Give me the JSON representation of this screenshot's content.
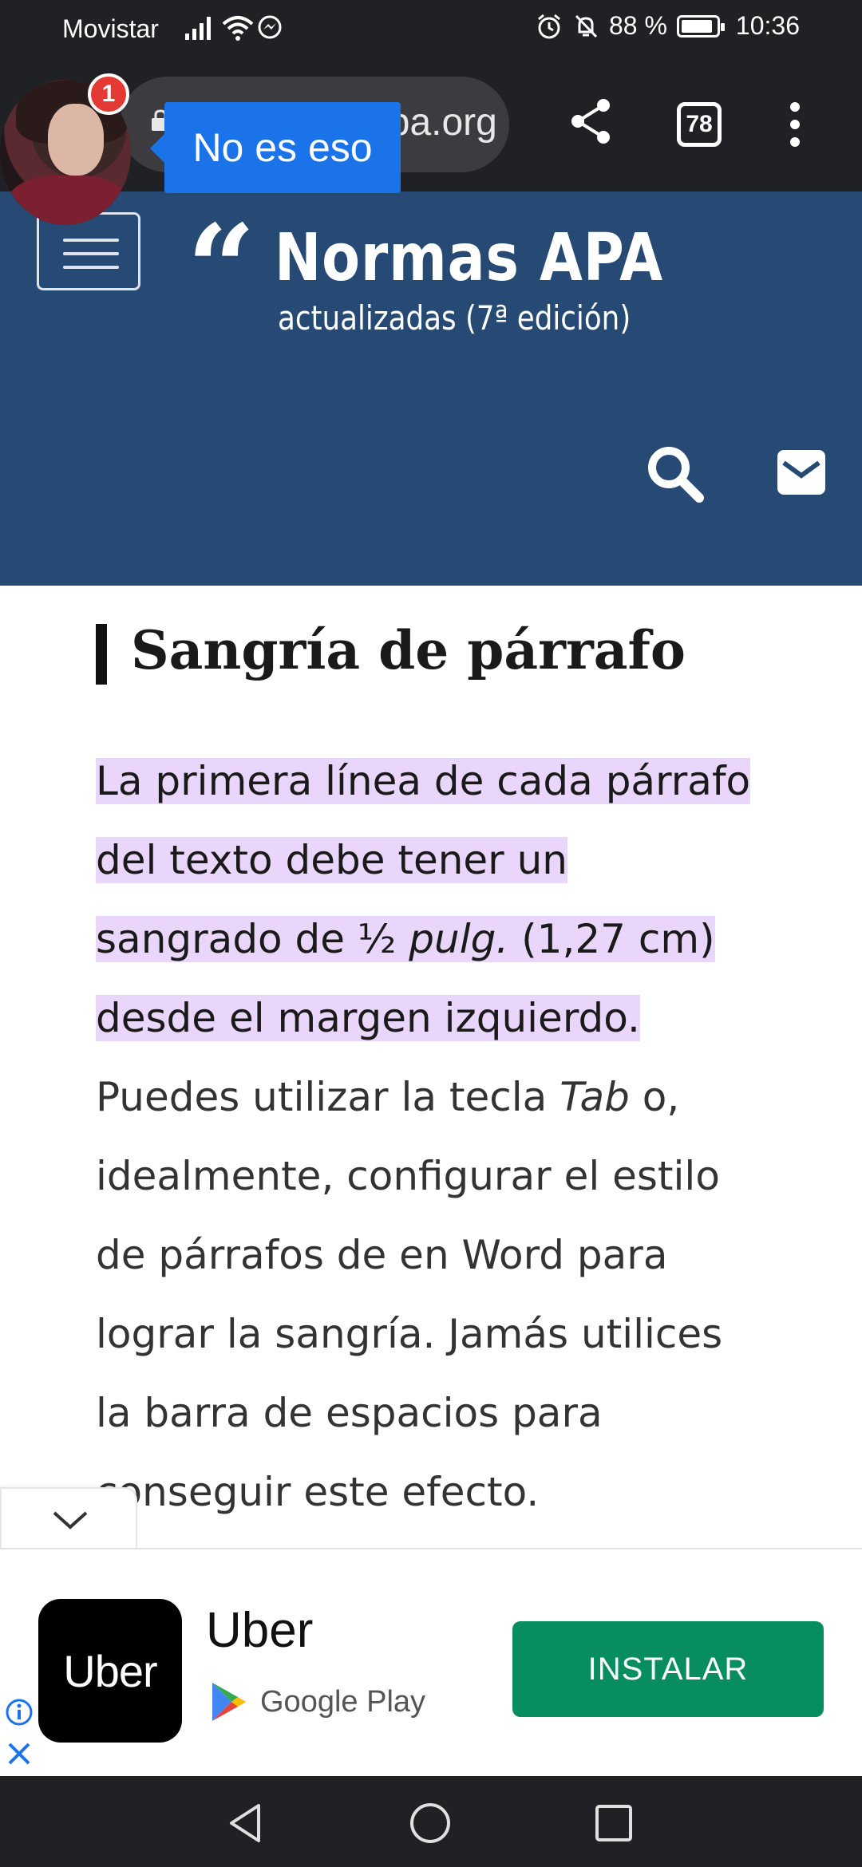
{
  "status_bar": {
    "carrier": "Movistar",
    "battery_percent": "88 %",
    "time": "10:36"
  },
  "browser": {
    "url_visible": "normasapa.org",
    "url_partial": "a.org",
    "tabs_count": "78"
  },
  "chat_head": {
    "badge_count": "1",
    "tooltip": "No es eso"
  },
  "site_header": {
    "logo_title": "Normas APA",
    "logo_subtitle": "actualizadas (7ª edición)",
    "colors": {
      "background": "#264a74"
    }
  },
  "article": {
    "heading": "Sangría de párrafo",
    "highlight_color": "#ead6fb",
    "lines": [
      {
        "hl": "La primera línea de cada párrafo"
      },
      {
        "hl": "del texto debe tener un"
      },
      {
        "hl_a": "sangrado de ½ ",
        "hl_b": "pulg.",
        "hl_c": " (1,27 cm)"
      },
      {
        "hl": "desde el margen izquierdo."
      },
      {
        "a": "Puedes utilizar la tecla ",
        "b": "Tab",
        "c": " o,"
      },
      {
        "text": "idealmente, configurar el estilo"
      },
      {
        "text": "de párrafos de en Word para"
      },
      {
        "text": "lograr la sangría. Jamás utilices"
      },
      {
        "text": "la barra de espacios para"
      },
      {
        "text": "conseguir este efecto."
      }
    ]
  },
  "ad": {
    "app_logo_text": "Uber",
    "app_name": "Uber",
    "store": "Google Play",
    "install_label": "INSTALAR",
    "colors": {
      "button": "#078d5f"
    }
  },
  "icons": [
    "signal-icon",
    "wifi-icon",
    "messenger-icon",
    "alarm-icon",
    "mute-icon",
    "battery-icon",
    "lock-icon",
    "share-icon",
    "more-icon",
    "search-icon",
    "mail-icon",
    "chevron-down-icon",
    "info-icon",
    "close-icon",
    "back-icon",
    "home-icon",
    "recents-icon"
  ]
}
